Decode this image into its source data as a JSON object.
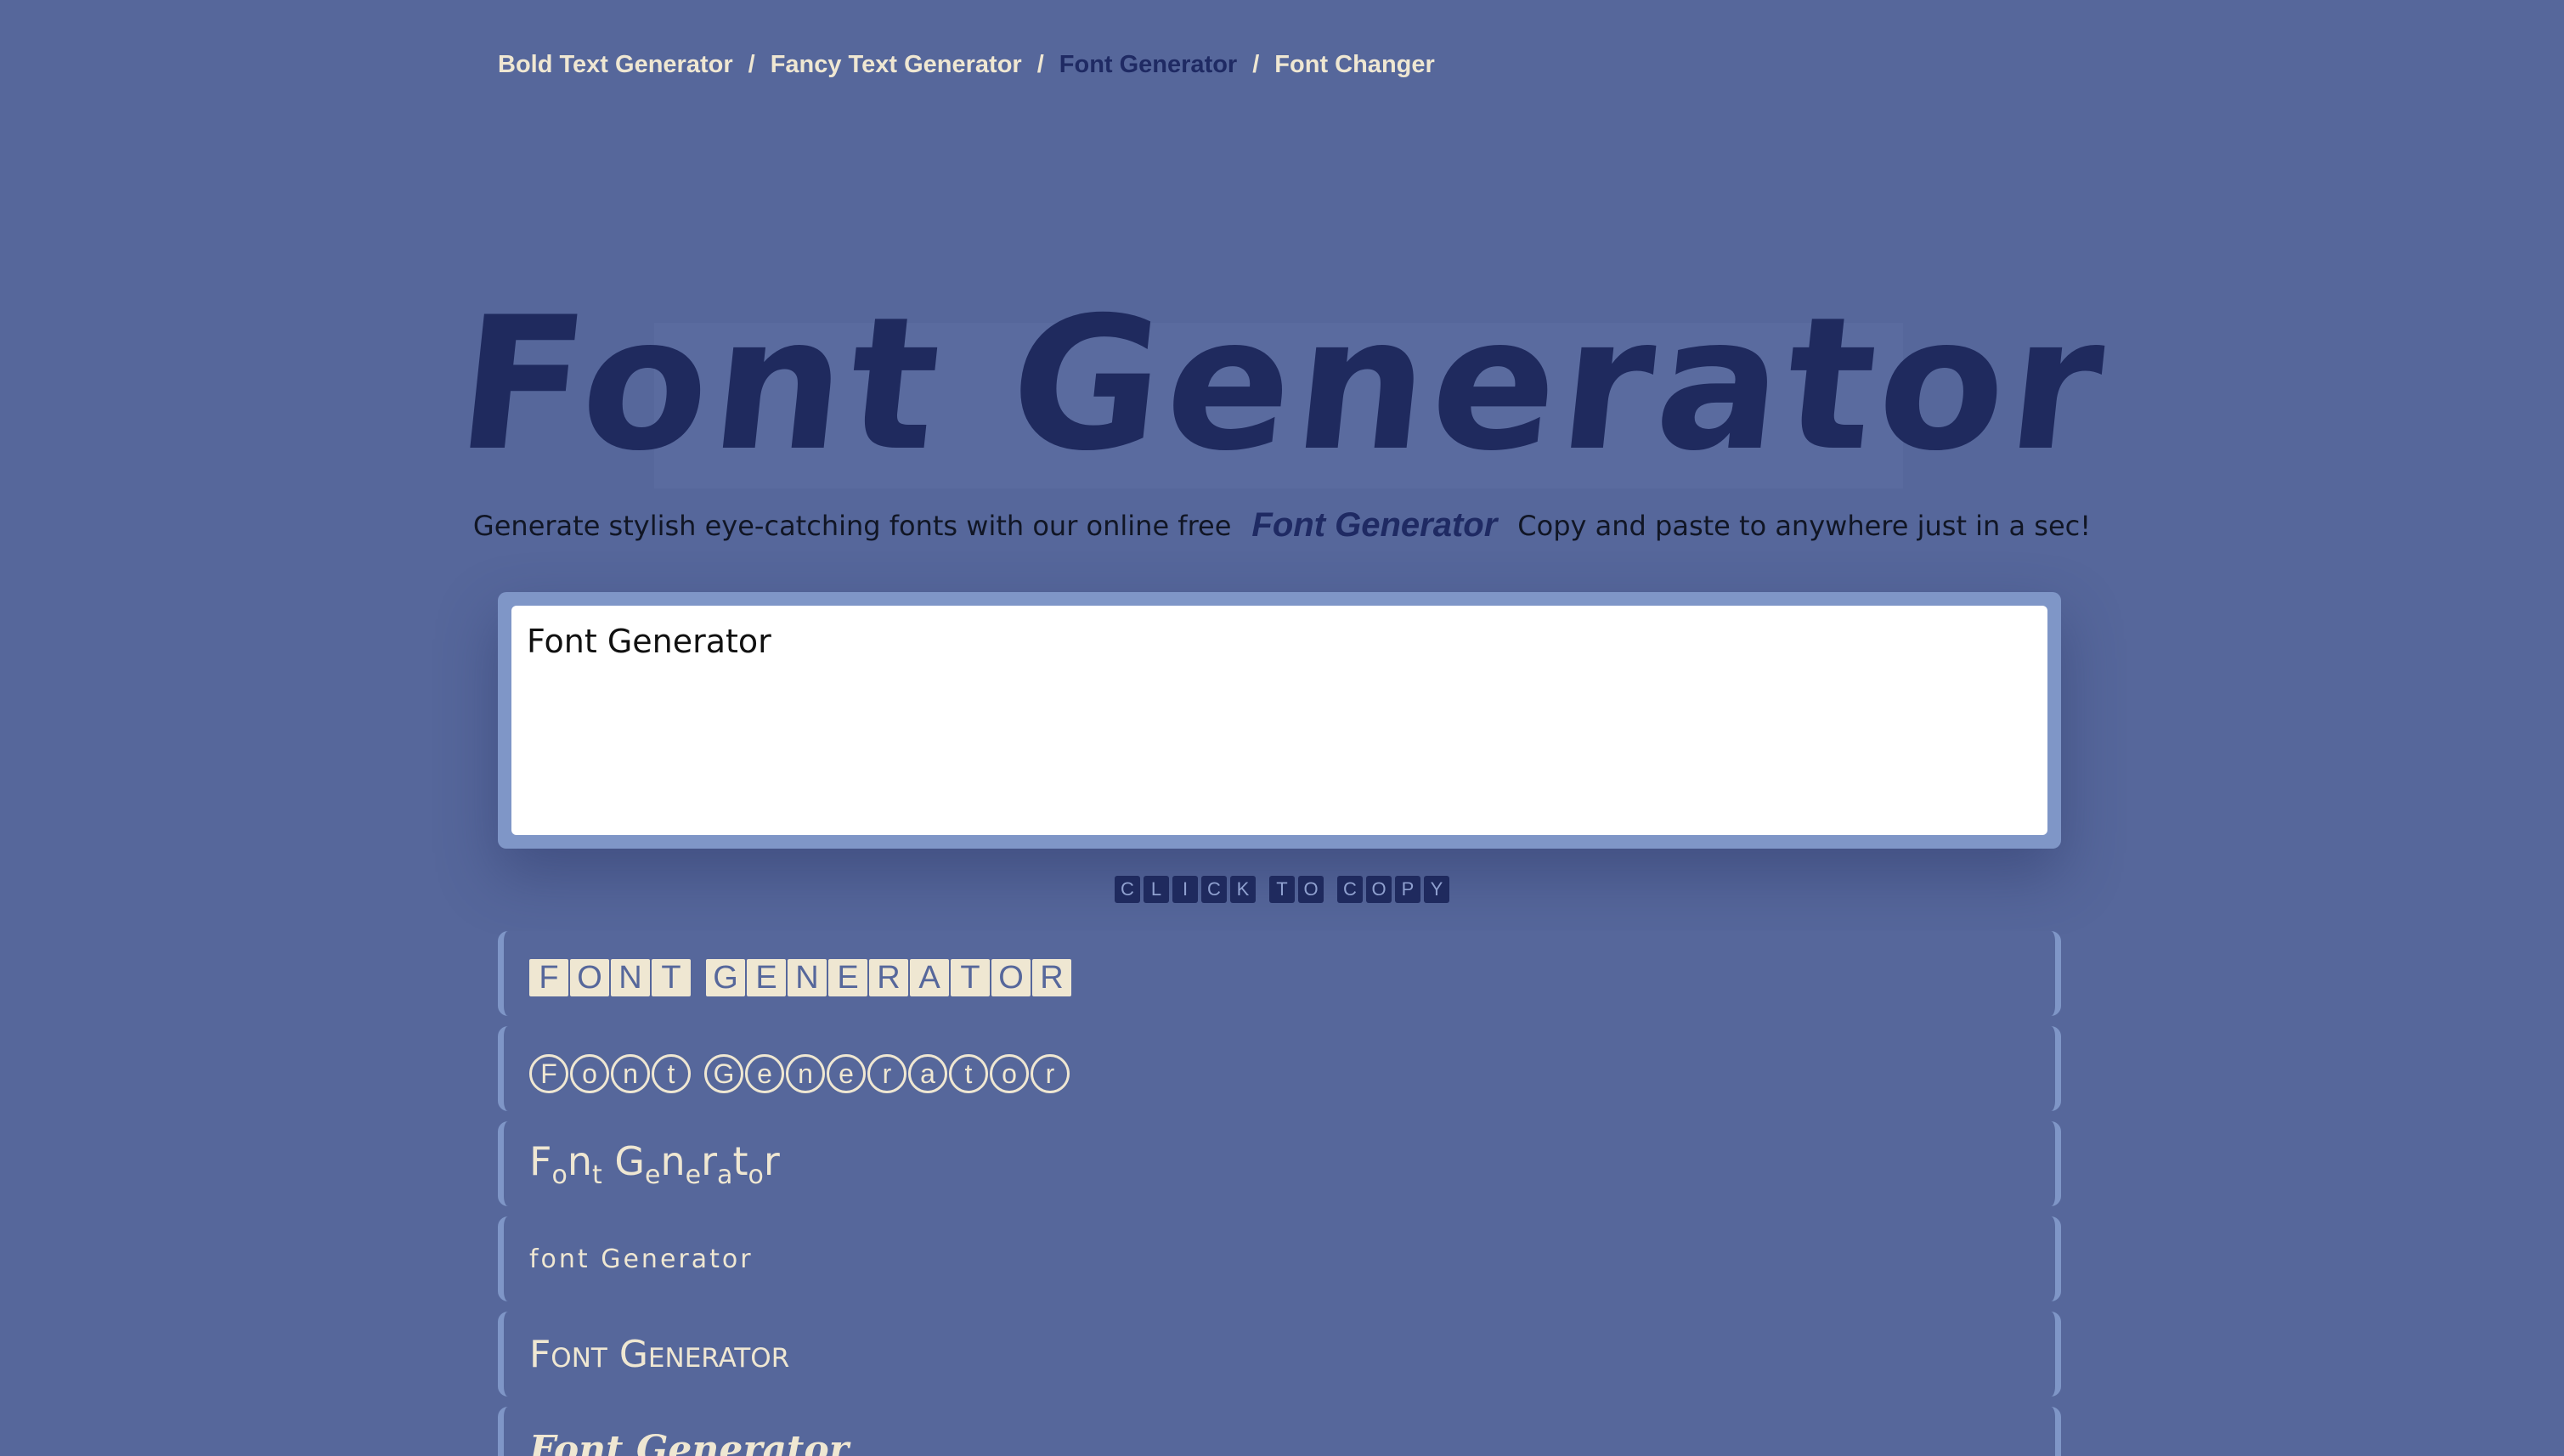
{
  "breadcrumb": {
    "items": [
      {
        "label": "Bold Text Generator",
        "active": false
      },
      {
        "label": "Fancy Text Generator",
        "active": false
      },
      {
        "label": "Font Generator",
        "active": true
      },
      {
        "label": "Font Changer",
        "active": false
      }
    ],
    "separator": "/"
  },
  "hero": {
    "title": "Font Generator",
    "subtitle_before": "Generate stylish eye-catching fonts with our online free",
    "subtitle_emphasis": "Font Generator",
    "subtitle_after": "Copy and paste to anywhere just in a sec!"
  },
  "input": {
    "value": "Font Generator"
  },
  "copy_hint": {
    "label": "CLICK TO COPY"
  },
  "results": [
    {
      "style": "boxed",
      "text": "FONT GENERATOR"
    },
    {
      "style": "circled",
      "text": "Font Generator"
    },
    {
      "style": "wave",
      "text": "Font Generator"
    },
    {
      "style": "tiny",
      "text": "font Generator"
    },
    {
      "style": "smallcaps",
      "text": "Font Generator"
    },
    {
      "style": "gothic",
      "text": "Font Generator"
    }
  ],
  "colors": {
    "background": "#56679b",
    "accent_dark": "#1f2a5e",
    "text_light": "#efe7d2",
    "card_border": "#7f96c7"
  }
}
